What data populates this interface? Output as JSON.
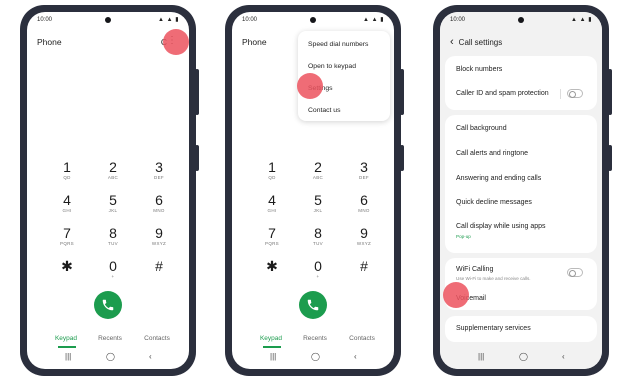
{
  "status": {
    "time": "10:00",
    "icons": "▲ ▲ ▮"
  },
  "panel1": {
    "title": "Phone",
    "title_truncated": "C",
    "more_icon": "⋮",
    "keys": [
      {
        "d": "1",
        "l": "QD"
      },
      {
        "d": "2",
        "l": "ABC"
      },
      {
        "d": "3",
        "l": "DEF"
      },
      {
        "d": "4",
        "l": "GHI"
      },
      {
        "d": "5",
        "l": "JKL"
      },
      {
        "d": "6",
        "l": "MNO"
      },
      {
        "d": "7",
        "l": "PQRS"
      },
      {
        "d": "8",
        "l": "TUV"
      },
      {
        "d": "9",
        "l": "WXYZ"
      },
      {
        "d": "✱",
        "l": ""
      },
      {
        "d": "0",
        "l": "+"
      },
      {
        "d": "#",
        "l": ""
      }
    ],
    "tabs": [
      "Keypad",
      "Recents",
      "Contacts"
    ]
  },
  "panel2": {
    "title": "Phone",
    "menu": [
      "Speed dial numbers",
      "Open to keypad",
      "Settings",
      "Contact us"
    ],
    "keys": [
      {
        "d": "1",
        "l": "QD"
      },
      {
        "d": "2",
        "l": "ABC"
      },
      {
        "d": "3",
        "l": "DEF"
      },
      {
        "d": "4",
        "l": "GHI"
      },
      {
        "d": "5",
        "l": "JKL"
      },
      {
        "d": "6",
        "l": "MNO"
      },
      {
        "d": "7",
        "l": "PQRS"
      },
      {
        "d": "8",
        "l": "TUV"
      },
      {
        "d": "9",
        "l": "WXYZ"
      },
      {
        "d": "✱",
        "l": ""
      },
      {
        "d": "0",
        "l": "+"
      },
      {
        "d": "#",
        "l": ""
      }
    ],
    "tabs": [
      "Keypad",
      "Recents",
      "Contacts"
    ]
  },
  "panel3": {
    "back_icon": "‹",
    "title": "Call settings",
    "rows": {
      "block": "Block numbers",
      "callerid": "Caller ID and spam protection",
      "background": "Call background",
      "alerts": "Call alerts and ringtone",
      "answering": "Answering and ending calls",
      "decline": "Quick decline messages",
      "display": "Call display while using apps",
      "display_sub": "Pop-up",
      "wifi": "WiFi Calling",
      "wifi_sub": "Use Wi-Fi to make and receive calls.",
      "voicemail": "Voicemail",
      "supplementary": "Supplementary services"
    }
  },
  "nav_icons": [
    "|||",
    "◯",
    "‹"
  ],
  "colors": {
    "accent_green": "#1c9c4e",
    "tap_marker": "#ec525e",
    "frame": "#2b2f3d"
  }
}
